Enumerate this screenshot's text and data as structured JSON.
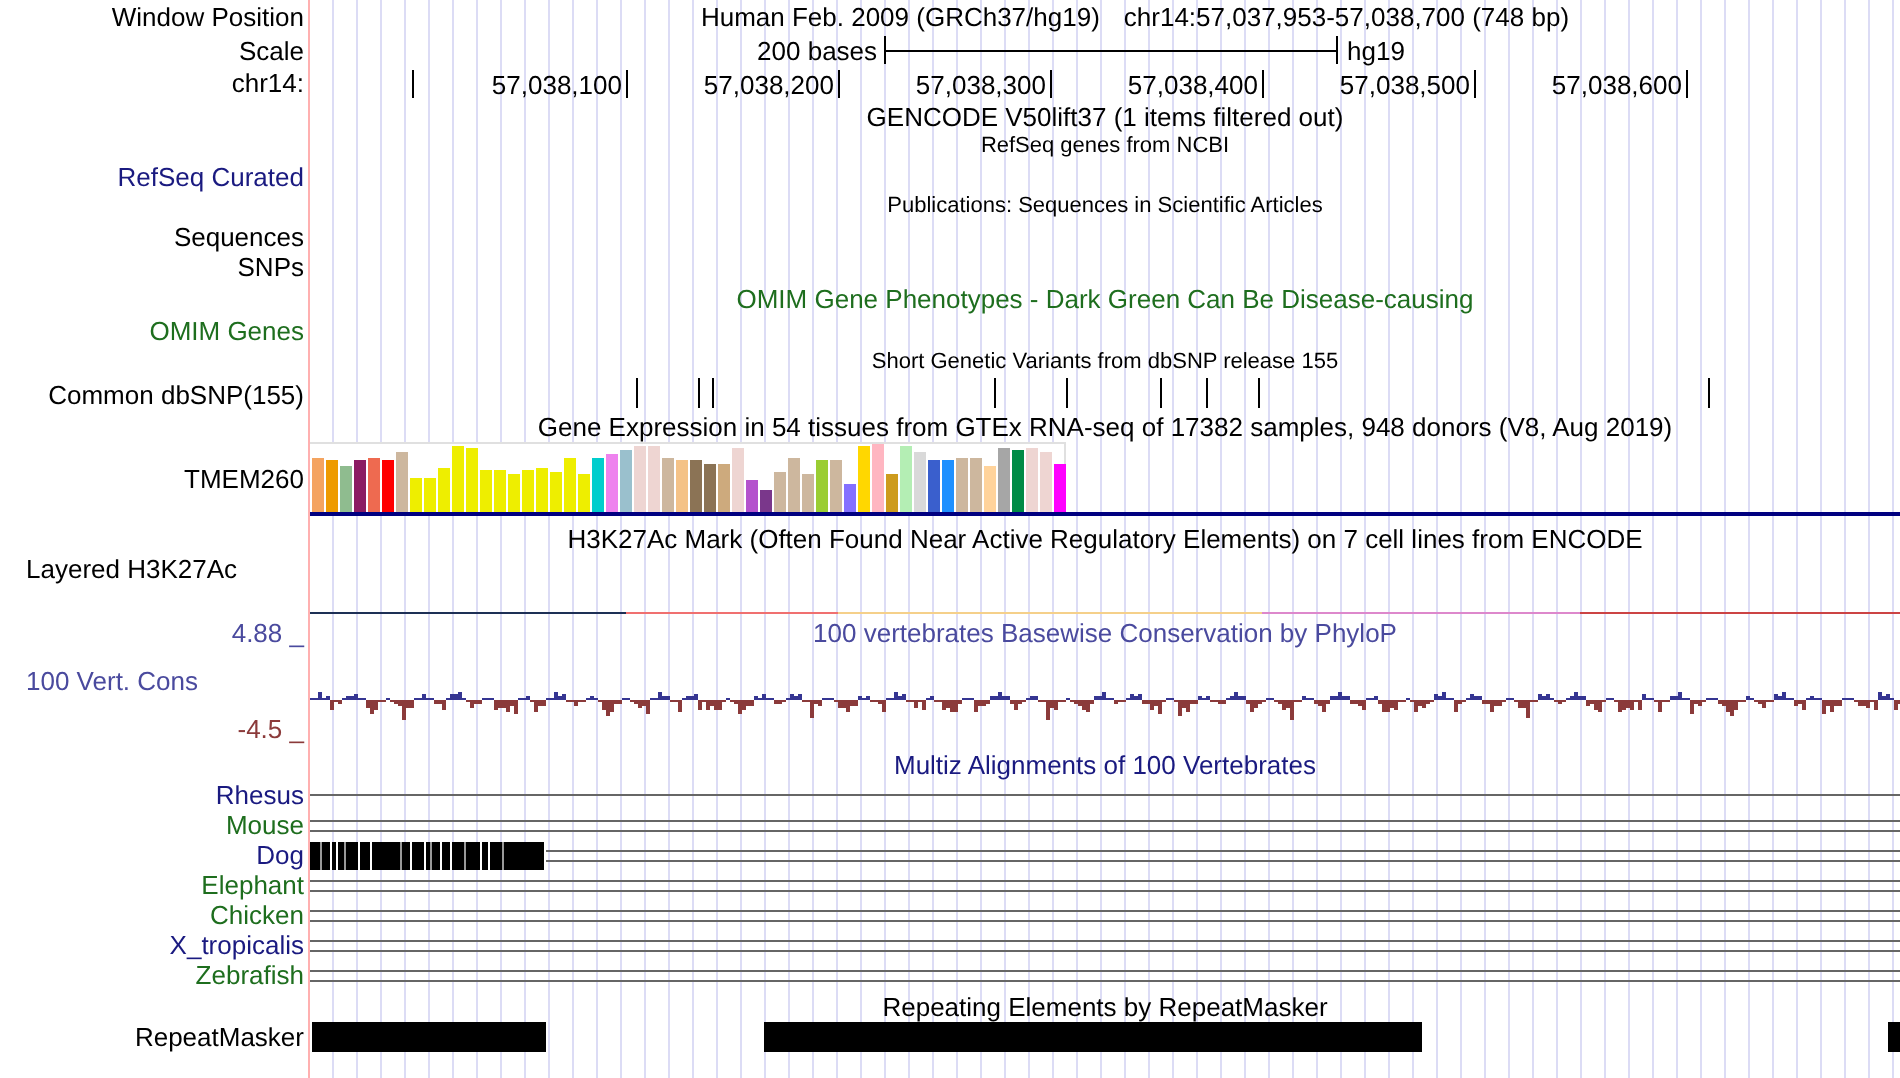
{
  "header": {
    "label": "Window Position",
    "assembly": "Human Feb. 2009 (GRCh37/hg19)",
    "position": "chr14:57,037,953-57,038,700 (748 bp)"
  },
  "scale": {
    "label": "Scale",
    "length": "200 bases",
    "assembly": "hg19"
  },
  "ruler": {
    "label": "chr14:",
    "ticks": [
      "57,038,100",
      "57,038,200",
      "57,038,300",
      "57,038,400",
      "57,038,500",
      "57,038,600"
    ]
  },
  "tracks": [
    {
      "kind": "gencode",
      "title": "GENCODE V50lift37 (1 items filtered out)",
      "color": "#000000"
    },
    {
      "kind": "refseq",
      "title": "RefSeq genes from NCBI",
      "label": "RefSeq Curated",
      "color": "#1a1a80"
    },
    {
      "kind": "publications",
      "title": "Publications: Sequences in Scientific Articles",
      "labels": [
        "Sequences",
        "SNPs"
      ],
      "color": "#000000"
    },
    {
      "kind": "omim",
      "title": "OMIM Gene Phenotypes - Dark Green Can Be Disease-causing",
      "label": "OMIM Genes",
      "color": "#1e6e1e"
    },
    {
      "kind": "snp",
      "title": "Short Genetic Variants from dbSNP release 155",
      "label": "Common dbSNP(155)",
      "color": "#000000"
    },
    {
      "kind": "gtex",
      "title": "Gene Expression in 54 tissues from GTEx RNA-seq of 17382 samples, 948 donors (V8, Aug 2019)",
      "label": "TMEM260",
      "color": "#000000"
    },
    {
      "kind": "h3k27ac",
      "title": "H3K27Ac Mark (Often Found Near Active Regulatory Elements) on 7 cell lines from ENCODE",
      "label": "Layered H3K27Ac",
      "color": "#000000"
    },
    {
      "kind": "phylop",
      "title": "100 vertebrates Basewise Conservation by PhyloP",
      "label": "100 Vert. Cons",
      "max": "4.88 _",
      "min": "-4.5 _",
      "color": "#4a4a9e"
    },
    {
      "kind": "multiz",
      "title": "Multiz Alignments of 100 Vertebrates",
      "color": "#1a1a80",
      "species": [
        {
          "name": "Rhesus",
          "color": "#1a1a80"
        },
        {
          "name": "Mouse",
          "color": "#1e6e1e"
        },
        {
          "name": "Dog",
          "color": "#1a1a80"
        },
        {
          "name": "Elephant",
          "color": "#1e6e1e"
        },
        {
          "name": "Chicken",
          "color": "#1e6e1e"
        },
        {
          "name": "X_tropicalis",
          "color": "#1a1a80"
        },
        {
          "name": "Zebrafish",
          "color": "#1e6e1e"
        }
      ]
    },
    {
      "kind": "repeatmasker",
      "title": "Repeating Elements by RepeatMasker",
      "label": "RepeatMasker",
      "color": "#000000"
    }
  ]
}
